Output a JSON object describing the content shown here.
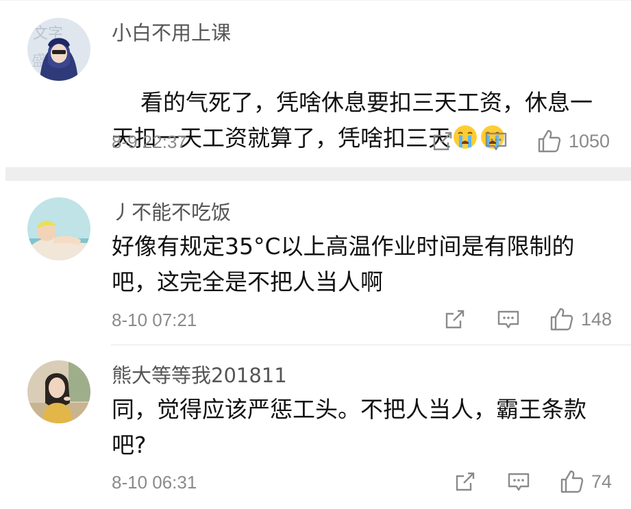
{
  "comments": [
    {
      "username": "小白不用上课",
      "content": "看的气死了，凭啥休息要扣三天工资，休息一天扣一天工资就算了，凭啥扣三天",
      "emoji_count": 2,
      "emoji_icon": "crying-face-icon",
      "time": "8-9 22:37",
      "likes": "1050"
    },
    {
      "username": "丿不能不吃饭",
      "content": "好像有规定35°C以上高温作业时间是有限制的吧，这完全是不把人当人啊",
      "time": "8-10 07:21",
      "likes": "148"
    },
    {
      "username": "熊大等等我201811",
      "content": "同，觉得应该严惩工头。不把人当人，霸王条款吧?",
      "time": "8-10 06:31",
      "likes": "74"
    }
  ],
  "icons": {
    "share": "share-icon",
    "reply": "comment-icon",
    "like": "thumbs-up-icon"
  },
  "colors": {
    "username": "#555555",
    "content": "#111111",
    "meta": "#8a8a8a",
    "divider": "#eeeeee"
  }
}
